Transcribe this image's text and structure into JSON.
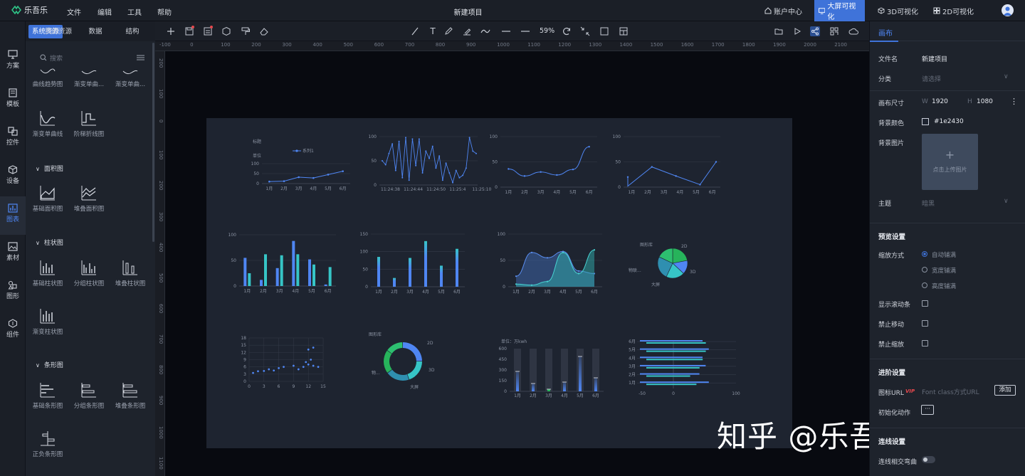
{
  "app": {
    "name": "乐吾乐",
    "project_title": "新建项目"
  },
  "menus": [
    "文件",
    "编辑",
    "工具",
    "帮助"
  ],
  "top_right": {
    "account": "账户中心",
    "bigscreen": "大屏可视化",
    "viz3d": "3D可视化",
    "viz2d": "2D可视化"
  },
  "sidebar": {
    "items": [
      {
        "label": "方案",
        "icon": "monitor-icon"
      },
      {
        "label": "模板",
        "icon": "template-icon"
      },
      {
        "label": "控件",
        "icon": "widget-icon"
      },
      {
        "label": "设备",
        "icon": "cube-icon"
      },
      {
        "label": "图表",
        "icon": "chart-icon"
      },
      {
        "label": "素材",
        "icon": "image-icon"
      },
      {
        "label": "图形",
        "icon": "shapes-icon"
      },
      {
        "label": "组件",
        "icon": "component-icon"
      }
    ]
  },
  "library": {
    "tabs": [
      "系统资源",
      "我的资源",
      "数据",
      "结构"
    ],
    "search_placeholder": "搜索",
    "top_items": [
      "曲线趋势图",
      "渐变单曲...",
      "渐变单曲..."
    ],
    "line_items": [
      "渐变单曲线",
      "阶梯折线图"
    ],
    "groups": [
      {
        "title": "面积图",
        "items": [
          "基础面积图",
          "堆叠面积图"
        ]
      },
      {
        "title": "柱状图",
        "items": [
          "基础柱状图",
          "分组柱状图",
          "堆叠柱状图",
          "渐变柱状图"
        ]
      },
      {
        "title": "条形图",
        "items": [
          "基础条形图",
          "分组条形图",
          "堆叠条形图",
          "正负条形图"
        ]
      }
    ]
  },
  "toolbar": {
    "zoom": "59%"
  },
  "rulers": {
    "top": [
      "-100",
      "0",
      "100",
      "200",
      "300",
      "400",
      "500",
      "600",
      "700",
      "800",
      "900",
      "1000",
      "1100",
      "1200",
      "1300",
      "1400",
      "1500",
      "1600",
      "1700",
      "1800",
      "1900",
      "2000",
      "2100"
    ],
    "left": [
      "200",
      "100",
      "0",
      "100",
      "200",
      "300",
      "400",
      "500",
      "600",
      "700",
      "800",
      "900",
      "1000",
      "1100"
    ]
  },
  "charts": {
    "c1": {
      "title": "标题",
      "legend": "系列1",
      "unit": "单位",
      "cats": [
        "1月",
        "2月",
        "3月",
        "4月",
        "5月",
        "6月"
      ],
      "yticks": [
        "100",
        "50",
        "0"
      ]
    },
    "c2": {
      "xticks": [
        "11:24:38",
        "11:24:44",
        "11:24:50",
        "11:25:4",
        "11:25:10"
      ],
      "yticks": [
        "100",
        "50",
        "0"
      ]
    },
    "c3": {
      "cats": [
        "1月",
        "2月",
        "3月",
        "4月",
        "5月",
        "6月"
      ],
      "yticks": [
        "100",
        "50",
        "0"
      ]
    },
    "c4": {
      "cats": [
        "1月",
        "2月",
        "3月",
        "4月",
        "5月",
        "6月"
      ],
      "yticks": [
        "100",
        "50",
        "0"
      ]
    },
    "c5": {
      "cats": [
        "1月",
        "2月",
        "3月",
        "4月",
        "5月",
        "6月"
      ],
      "yticks": [
        "100",
        "50",
        "0"
      ]
    },
    "c6": {
      "cats": [
        "1月",
        "2月",
        "3月",
        "4月",
        "5月",
        "6月"
      ],
      "yticks": [
        "150",
        "100",
        "50",
        "0"
      ]
    },
    "c7": {
      "cats": [
        "1月",
        "2月",
        "3月",
        "4月",
        "5月",
        "6月"
      ],
      "yticks": [
        "100",
        "50",
        "0"
      ]
    },
    "c8": {
      "labels": [
        "图形库",
        "2D",
        "3D",
        "大屏",
        "物联..."
      ]
    },
    "c9": {
      "xticks": [
        "0",
        "3",
        "6",
        "9",
        "12",
        "15"
      ],
      "yticks": [
        "18",
        "15",
        "12",
        "9",
        "6",
        "3",
        "0"
      ]
    },
    "c10": {
      "labels": [
        "图形库",
        "2D",
        "3D",
        "大屏",
        "物..."
      ]
    },
    "c11": {
      "unit": "单位：万kwh",
      "cats": [
        "1月",
        "2月",
        "3月",
        "4月",
        "5月",
        "6月"
      ],
      "yticks": [
        "600",
        "450",
        "300",
        "150",
        "0"
      ]
    },
    "c12": {
      "cats": [
        "6月",
        "5月",
        "4月",
        "3月",
        "2月",
        "1月"
      ],
      "xticks": [
        "-50",
        "0",
        "100"
      ]
    }
  },
  "chart_data": [
    {
      "type": "line",
      "title": "标题",
      "categories": [
        "1月",
        "2月",
        "3月",
        "4月",
        "5月",
        "6月"
      ],
      "series": [
        {
          "name": "系列1",
          "values": [
            10,
            12,
            32,
            28,
            45,
            62
          ]
        }
      ],
      "ylim": [
        0,
        100
      ]
    },
    {
      "type": "line",
      "categories": [
        "11:24:38",
        "11:24:44",
        "11:24:50",
        "11:25:4",
        "11:25:10"
      ],
      "series": [
        {
          "values": [
            50,
            42,
            65,
            85,
            30,
            90,
            15,
            98,
            10,
            95,
            40,
            95,
            25,
            70,
            55,
            80,
            35,
            60,
            10,
            45,
            25,
            5,
            30,
            15,
            20,
            35,
            98,
            70,
            65
          ]
        }
      ],
      "ylim": [
        0,
        100
      ]
    },
    {
      "type": "line",
      "categories": [
        "1月",
        "2月",
        "3月",
        "4月",
        "5月",
        "6月"
      ],
      "series": [
        {
          "values": [
            36,
            22,
            30,
            24,
            35,
            80
          ]
        }
      ],
      "ylim": [
        0,
        100
      ]
    },
    {
      "type": "line",
      "categories": [
        "1月",
        "2月",
        "3月",
        "4月",
        "5月",
        "6月"
      ],
      "series": [
        {
          "values": [
            20,
            2,
            40,
            40,
            22,
            22,
            5,
            5,
            50,
            50
          ]
        }
      ],
      "ylim": [
        0,
        100
      ]
    },
    {
      "type": "bar",
      "categories": [
        "1月",
        "2月",
        "3月",
        "4月",
        "5月",
        "6月"
      ],
      "series": [
        {
          "values": [
            55,
            12,
            35,
            88,
            52,
            3
          ]
        },
        {
          "values": [
            25,
            62,
            60,
            62,
            42,
            37
          ]
        }
      ],
      "ylim": [
        0,
        100
      ]
    },
    {
      "type": "bar",
      "categories": [
        "1月",
        "2月",
        "3月",
        "4月",
        "5月",
        "6月"
      ],
      "series": [
        {
          "values": [
            85,
            25,
            82,
            130,
            60,
            108
          ]
        }
      ],
      "ylim": [
        0,
        150
      ]
    },
    {
      "type": "area",
      "categories": [
        "1月",
        "2月",
        "3月",
        "4月",
        "5月",
        "6月"
      ],
      "series": [
        {
          "values": [
            20,
            65,
            55,
            67,
            30,
            25
          ]
        },
        {
          "values": [
            5,
            3,
            10,
            65,
            25,
            70
          ]
        }
      ],
      "ylim": [
        0,
        100
      ]
    },
    {
      "type": "pie",
      "labels": [
        "图形库",
        "2D",
        "3D",
        "大屏",
        "物联..."
      ],
      "values": [
        22,
        15,
        20,
        25,
        18
      ]
    },
    {
      "type": "scatter",
      "xlim": [
        0,
        15
      ],
      "ylim": [
        0,
        18
      ],
      "points": [
        [
          0.8,
          3.5
        ],
        [
          1.8,
          4.2
        ],
        [
          3,
          4.3
        ],
        [
          4,
          5
        ],
        [
          5,
          4.5
        ],
        [
          6,
          5.5
        ],
        [
          7,
          6
        ],
        [
          9,
          6.5
        ],
        [
          10,
          5
        ],
        [
          11,
          6
        ],
        [
          11.5,
          8
        ],
        [
          12,
          7
        ],
        [
          12.5,
          9
        ],
        [
          13,
          6.5
        ],
        [
          14,
          6
        ],
        [
          12,
          13.2
        ],
        [
          13,
          14
        ]
      ]
    },
    {
      "type": "pie",
      "labels": [
        "图形库",
        "2D",
        "3D",
        "大屏",
        "物..."
      ],
      "values": [
        25,
        20,
        20,
        20,
        15
      ]
    },
    {
      "type": "bar",
      "categories": [
        "1月",
        "2月",
        "3月",
        "4月",
        "5月",
        "6月"
      ],
      "values": [
        280,
        110,
        30,
        130,
        490,
        190
      ],
      "ylim": [
        0,
        600
      ]
    },
    {
      "type": "bar",
      "categories": [
        "6月",
        "5月",
        "4月",
        "3月",
        "2月",
        "1月"
      ],
      "series": [
        {
          "values": [
            100,
            110,
            100,
            105,
            95,
            110
          ]
        },
        {
          "values": [
            95,
            95,
            90,
            85,
            70,
            80
          ]
        }
      ],
      "xlim": [
        -50,
        100
      ]
    }
  ],
  "properties": {
    "tab": "画布",
    "file_name_label": "文件名",
    "file_name": "新建项目",
    "category_label": "分类",
    "category_placeholder": "请选择",
    "size_label": "画布尺寸",
    "w_label": "W",
    "width": "1920",
    "h_label": "H",
    "height": "1080",
    "bg_color_label": "背景颜色",
    "bg_color": "#1e2430",
    "bg_image_label": "背景图片",
    "upload_hint": "点击上传图片",
    "theme_label": "主题",
    "theme_placeholder": "暗黑",
    "preview_section": "预览设置",
    "scale_label": "缩放方式",
    "scale_options": [
      "自动铺满",
      "宽度铺满",
      "高度铺满"
    ],
    "scrollbar_label": "显示滚动条",
    "disable_move_label": "禁止移动",
    "disable_zoom_label": "禁止缩放",
    "advanced_section": "进阶设置",
    "icon_url_label": "图标URL",
    "vip": "VIP",
    "icon_url_placeholder": "Font class方式URL",
    "add_button": "添加",
    "init_action_label": "初始化动作",
    "init_action_value": "···",
    "connection_section": "连线设置",
    "line_cross_label": "连线相交弯曲"
  },
  "watermark": "知乎 @乐吾乐可视化",
  "colors": {
    "accent": "#3f73d9",
    "line": "#4f86f3",
    "teal": "#36c5c6",
    "green": "#27b35b",
    "canvas": "#1e2430"
  }
}
